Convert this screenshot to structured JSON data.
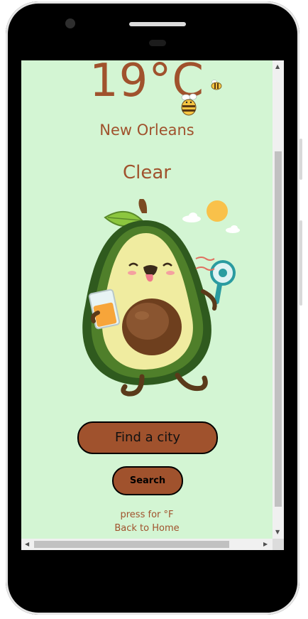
{
  "weather": {
    "temperature": "19°C",
    "city": "New Orleans",
    "condition": "Clear"
  },
  "controls": {
    "find_city_label": "Find a city",
    "search_label": "Search",
    "unit_toggle": "press for °F",
    "home_link": "Back to Home"
  },
  "illustration": {
    "subject": "avocado-with-juice-and-fan-icon",
    "decorations": [
      "sun-icon",
      "cloud-icon",
      "bee-icon"
    ]
  },
  "colors": {
    "background": "#d3f5d3",
    "accent": "#a0522d",
    "device": "#000000"
  }
}
